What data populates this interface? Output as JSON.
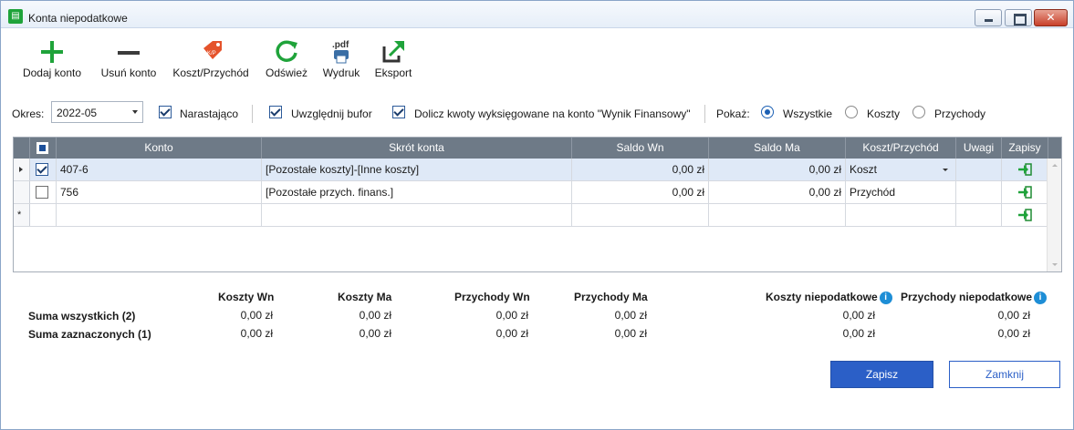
{
  "window": {
    "title": "Konta niepodatkowe",
    "icon": "ledger-icon"
  },
  "toolbar": {
    "add_label": "Dodaj konto",
    "remove_label": "Usuń konto",
    "cost_income_label": "Koszt/Przychód",
    "refresh_label": "Odśwież",
    "print_label": "Wydruk",
    "print_icon_text": ".pdf",
    "export_label": "Eksport"
  },
  "filters": {
    "period_label": "Okres:",
    "period_value": "2022-05",
    "cumulative_label": "Narastająco",
    "cumulative_checked": true,
    "buffer_label": "Uwzględnij bufor",
    "buffer_checked": true,
    "include_label": "Dolicz kwoty wyksięgowane na konto \"Wynik Finansowy\"",
    "include_checked": true,
    "show_label": "Pokaż:",
    "show_options": [
      "Wszystkie",
      "Koszty",
      "Przychody"
    ],
    "show_selected": "Wszystkie"
  },
  "grid": {
    "columns": [
      "Konto",
      "Skrót konta",
      "Saldo Wn",
      "Saldo Ma",
      "Koszt/Przychód",
      "Uwagi",
      "Zapisy"
    ],
    "rows": [
      {
        "checked": true,
        "konto": "407-6",
        "skrot": "[Pozostałe koszty]-[Inne koszty]",
        "saldo_wn": "0,00 zł",
        "saldo_ma": "0,00 zł",
        "typ": "Koszt",
        "uwagi": ""
      },
      {
        "checked": false,
        "konto": "756",
        "skrot": "[Pozostałe przych. finans.]",
        "saldo_wn": "0,00 zł",
        "saldo_ma": "0,00 zł",
        "typ": "Przychód",
        "uwagi": ""
      }
    ],
    "new_row_marker": "*"
  },
  "summary": {
    "headers": {
      "koszty_wn": "Koszty Wn",
      "koszty_ma": "Koszty Ma",
      "przychody_wn": "Przychody Wn",
      "przychody_ma": "Przychody Ma",
      "koszty_niepod": "Koszty niepodatkowe",
      "przychody_niepod": "Przychody niepodatkowe"
    },
    "all_label": "Suma wszystkich (2)",
    "selected_label": "Suma zaznaczonych (1)",
    "all": {
      "koszty_wn": "0,00 zł",
      "koszty_ma": "0,00 zł",
      "przychody_wn": "0,00 zł",
      "przychody_ma": "0,00 zł",
      "koszty_niepod": "0,00 zł",
      "przychody_niepod": "0,00 zł"
    },
    "selected": {
      "koszty_wn": "0,00 zł",
      "koszty_ma": "0,00 zł",
      "przychody_wn": "0,00 zł",
      "przychody_ma": "0,00 zł",
      "koszty_niepod": "0,00 zł",
      "przychody_niepod": "0,00 zł"
    },
    "info_glyph": "i"
  },
  "buttons": {
    "save_label": "Zapisz",
    "close_label": "Zamknij"
  },
  "colors": {
    "accent": "#2b5fc7",
    "header": "#6e7a87",
    "selected_row": "#dfe9f7",
    "add_green": "#1fa33a"
  }
}
